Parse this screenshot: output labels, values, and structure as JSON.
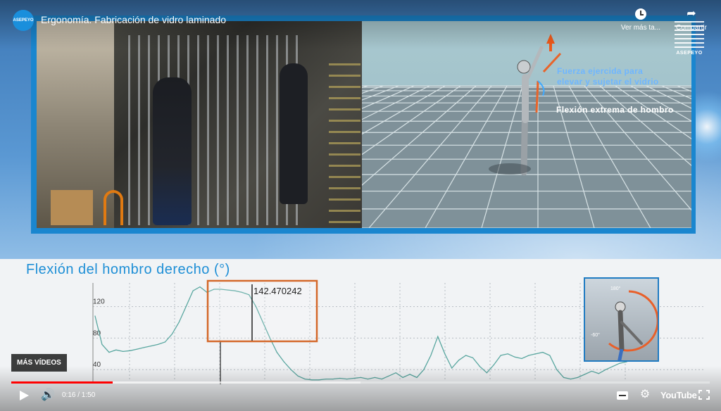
{
  "player": {
    "title": "Ergonomía. Fabricación de vidro laminado",
    "channel_logo_text": "ASEPEYO",
    "watch_later_label": "Ver más ta...",
    "share_label": "Compartir",
    "watermark": "ASEPEYO"
  },
  "overlay": {
    "force_label": "Fuerza ejercida para elevar y sujetar el vidrio",
    "flexion_label": "Flexión extrema de hombro"
  },
  "chart": {
    "title": "Flexión del hombro derecho (°)",
    "highlight_value": "142.470242",
    "inset_top_label": "180°",
    "inset_side_label": "-60°"
  },
  "chart_data": {
    "type": "line",
    "title": "Flexión del hombro derecho (°)",
    "yticks": [
      40,
      80,
      120
    ],
    "ylim": [
      25,
      150
    ],
    "highlight_value": 142.470242,
    "series": [
      {
        "values": [
          108,
          72,
          62,
          65,
          63,
          64,
          66,
          68,
          70,
          72,
          75,
          85,
          100,
          120,
          140,
          145,
          138,
          142,
          142,
          141,
          140,
          138,
          135,
          120,
          100,
          80,
          62,
          50,
          40,
          32,
          28,
          27,
          27,
          28,
          28,
          29,
          28,
          29,
          30,
          28,
          30,
          28,
          32,
          36,
          30,
          34,
          30,
          40,
          58,
          82,
          60,
          42,
          52,
          58,
          55,
          44,
          36,
          46,
          58,
          60,
          56,
          54,
          58,
          60,
          62,
          58,
          40,
          30,
          28,
          30,
          34,
          38,
          35,
          40,
          44,
          48,
          50,
          58
        ]
      }
    ]
  },
  "controls": {
    "more_videos": "MÁS VÍDEOS",
    "time": "0:16 / 1:50",
    "progress": 0.145,
    "buffered": 0.5,
    "youtube_logo": "YouTube"
  },
  "colors": {
    "accent_blue": "#1a86cf",
    "progress_red": "#ff0000",
    "chart_line": "#5aa7a0",
    "highlight_box": "#d4682a"
  }
}
